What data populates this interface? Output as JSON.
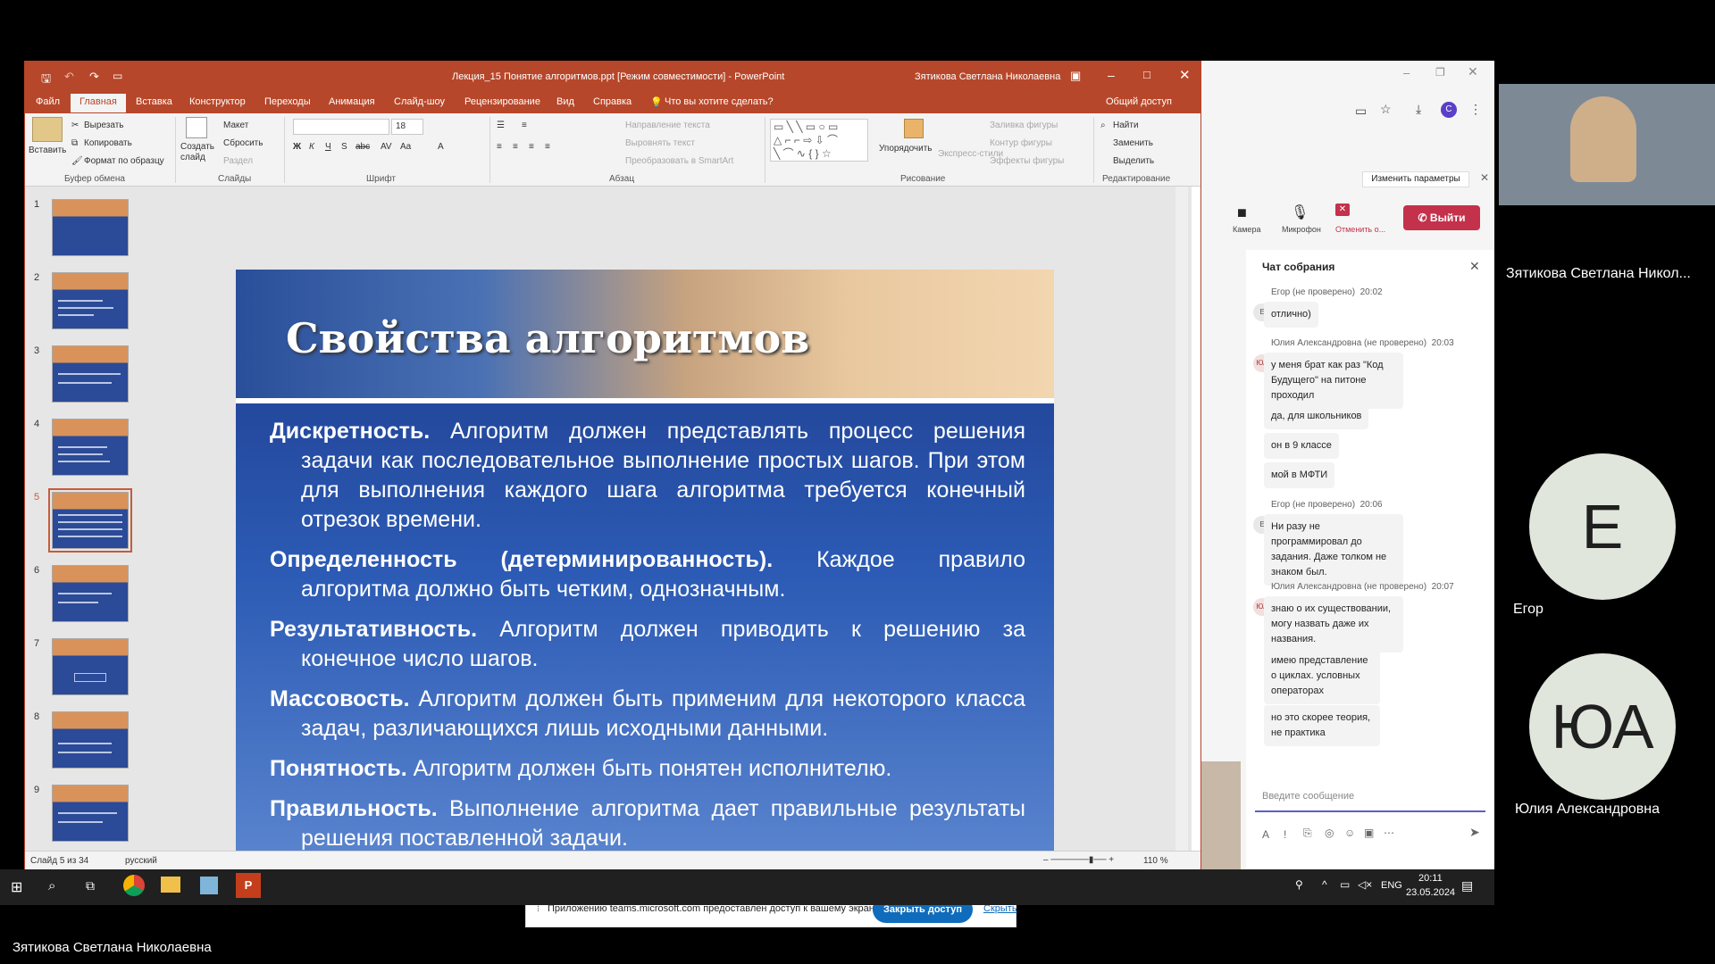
{
  "ppt": {
    "window_title": "Лекция_15 Понятие алгоритмов.ppt [Режим совместимости] - PowerPoint",
    "user": "Зятикова Светлана Николаевна",
    "tabs": [
      "Файл",
      "Главная",
      "Вставка",
      "Конструктор",
      "Переходы",
      "Анимация",
      "Слайд-шоу",
      "Рецензирование",
      "Вид",
      "Справка"
    ],
    "tell_me": "Что вы хотите сделать?",
    "share": "Общий доступ",
    "ribbon": {
      "paste": "Вставить",
      "cut": "Вырезать",
      "copy": "Копировать",
      "format_painter": "Формат по образцу",
      "group_clipboard": "Буфер обмена",
      "new_slide": "Создать слайд",
      "layout": "Макет",
      "reset": "Сбросить",
      "section": "Раздел",
      "group_slides": "Слайды",
      "font_size": "18",
      "group_font": "Шрифт",
      "text_direction": "Направление текста",
      "align_text": "Выровнять текст",
      "smartart": "Преобразовать в SmartArt",
      "group_paragraph": "Абзац",
      "arrange": "Упорядочить",
      "quick_styles": "Экспресс-стили",
      "shape_fill": "Заливка фигуры",
      "shape_outline": "Контур фигуры",
      "shape_effects": "Эффекты фигуры",
      "group_drawing": "Рисование",
      "find": "Найти",
      "replace": "Заменить",
      "select": "Выделить",
      "group_editing": "Редактирование"
    },
    "slide_numbers": [
      "1",
      "2",
      "3",
      "4",
      "5",
      "6",
      "7",
      "8",
      "9"
    ],
    "slide": {
      "title": "Свойства алгоритмов",
      "items": [
        {
          "term": "Дискретность.",
          "text": " Алгоритм должен представлять процесс решения задачи как последовательное выполнение простых шагов. При этом для выполнения каждого шага алгоритма требуется конечный отрезок времени."
        },
        {
          "term": "Определенность (детерминированность).",
          "text": " Каждое правило алгоритма должно быть четким, однозначным."
        },
        {
          "term": "Результативность.",
          "text": " Алгоритм должен приводить к решению за конечное число шагов."
        },
        {
          "term": "Массовость.",
          "text": " Алгоритм должен быть применим для некоторого класса задач, различающихся лишь исходными данными."
        },
        {
          "term": "Понятность.",
          "text": "  Алгоритм должен быть понятен исполнителю."
        },
        {
          "term": "Правильность.",
          "text": " Выполнение алгоритма дает правильные результаты решения поставленной задачи."
        }
      ]
    },
    "status": {
      "slide_of": "Слайд 5 из 34",
      "language": "русский",
      "zoom": "110 %"
    },
    "share_bar": {
      "text": "Приложению teams.microsoft.com предоставлен доступ к вашему экрану.",
      "close": "Закрыть доступ",
      "hide": "Скрыть"
    }
  },
  "teams": {
    "change_settings": "Изменить параметры",
    "camera": "Камера",
    "mic": "Микрофон",
    "stop": "Отменить о...",
    "leave": "Выйти",
    "chat_title": "Чат собрания",
    "messages": [
      {
        "author": "Егор (не проверено)",
        "time": "20:02",
        "initials": "Е",
        "texts": [
          "отлично)"
        ]
      },
      {
        "author": "Юлия Александровна (не проверено)",
        "time": "20:03",
        "initials": "ЮА",
        "texts": [
          "у меня брат как раз \"Код Будущего\" на питоне проходил",
          "да, для школьников",
          "он в 9 классе",
          "мой в МФТИ"
        ]
      },
      {
        "author": "Егор (не проверено)",
        "time": "20:06",
        "initials": "Е",
        "texts": [
          "Ни разу не программировал до задания. Даже толком не знаком был."
        ]
      },
      {
        "author": "Юлия Александровна (не проверено)",
        "time": "20:07",
        "initials": "ЮА",
        "texts": [
          "знаю о их существовании, могу назвать даже их названия.",
          "имею представление о циклах. условных операторах",
          "но это скорее теория, не практика"
        ]
      }
    ],
    "input_placeholder": "Введите сообщение"
  },
  "participants": [
    {
      "name": "Зятикова Светлана Никол...",
      "initials": ""
    },
    {
      "name": "Егор",
      "initials": "Е"
    },
    {
      "name": "Юлия Александровна",
      "initials": "ЮА"
    }
  ],
  "taskbar": {
    "lang": "ENG",
    "time": "20:11",
    "date": "23.05.2024"
  },
  "presenter_caption": "Зятикова Светлана Николаевна"
}
